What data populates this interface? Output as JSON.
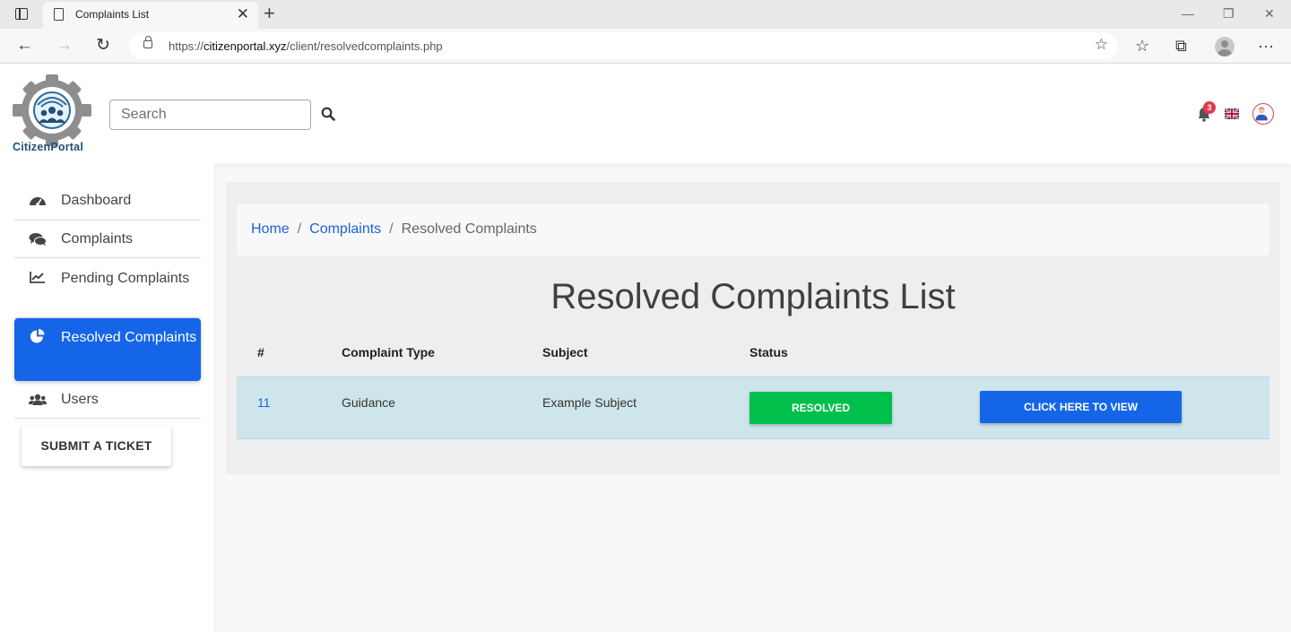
{
  "browser": {
    "tab_title": "Complaints List",
    "tab_close": "✕",
    "new_tab": "+",
    "url_prefix": "https://",
    "url_host": "citizenportal.xyz",
    "url_path": "/client/resolvedcomplaints.php",
    "controls": {
      "minimize": "—",
      "restore": "❐",
      "close": "✕"
    }
  },
  "header": {
    "logo_text": "CitizenPortal",
    "search": {
      "placeholder": "Search",
      "value": ""
    },
    "notifications_count": "3",
    "language_icon": "uk-flag-icon"
  },
  "sidebar": {
    "items": [
      {
        "label": "Dashboard",
        "icon": "dashboard-gauge-icon"
      },
      {
        "label": "Complaints",
        "icon": "comments-icon"
      },
      {
        "label": "Pending Complaints",
        "icon": "line-chart-icon"
      },
      {
        "label": "Resolved Complaints",
        "icon": "pie-chart-icon"
      },
      {
        "label": "Users",
        "icon": "users-icon"
      }
    ],
    "submit_label": "SUBMIT A TICKET"
  },
  "breadcrumb": {
    "home": "Home",
    "separator": "/",
    "complaints": "Complaints",
    "current": "Resolved Complaints"
  },
  "main": {
    "title": "Resolved Complaints List",
    "table": {
      "headers": [
        "#",
        "Complaint Type",
        "Subject",
        "Status"
      ],
      "rows": [
        {
          "id": "11",
          "type": "Guidance",
          "subject": "Example Subject",
          "status": "RESOLVED",
          "action": "CLICK HERE TO VIEW"
        }
      ]
    }
  },
  "colors": {
    "primary": "#1565e8",
    "success": "#00bf4a",
    "row_highlight": "#cde5eb",
    "badge": "#e3374a"
  }
}
